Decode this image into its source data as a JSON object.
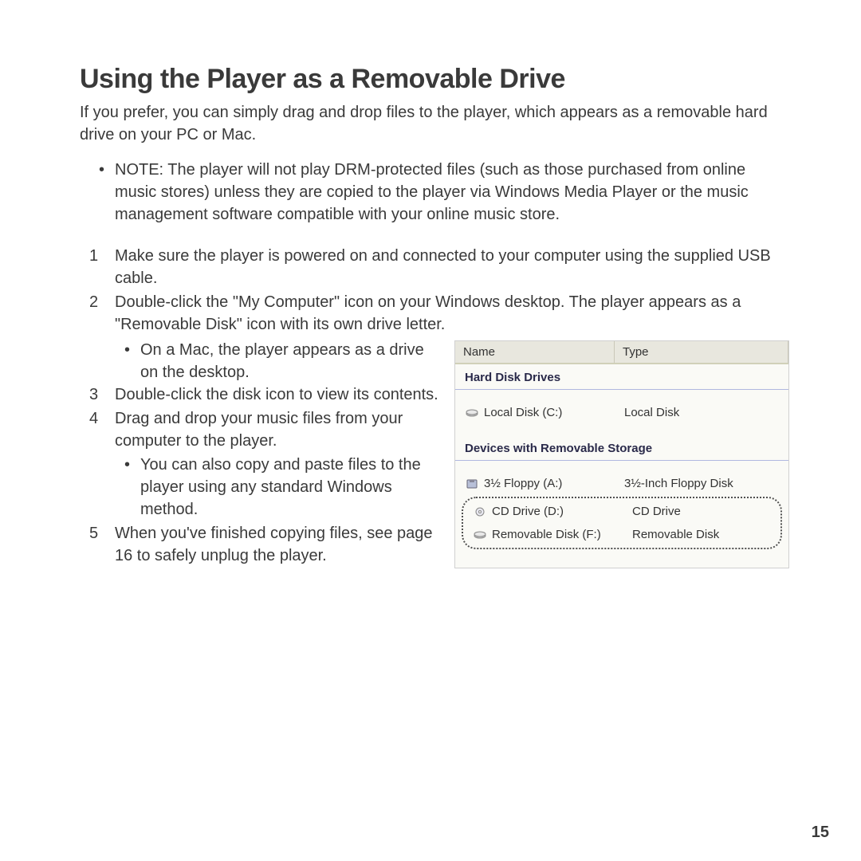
{
  "title": "Using the Player as a Removable Drive",
  "intro": "If you prefer, you can simply drag and drop files to the player, which appears as a removable hard drive on your PC or Mac.",
  "note": "NOTE: The player will not play DRM-protected files (such as those purchased from online music stores) unless they are copied to the player via Windows Media Player or the music management software compatible with your online music store.",
  "steps": {
    "s1": "Make sure the player is powered on and connected to your computer using the supplied USB cable.",
    "s2": "Double-click the \"My Computer\" icon on your Windows desktop. The player appears as a \"Removable Disk\" icon with its own drive letter.",
    "s2_sub": "On a Mac, the player appears as a drive on the desktop.",
    "s3": "Double-click the disk icon to view its contents.",
    "s4": "Drag and drop your music files from your computer to the player.",
    "s4_sub": "You can also copy and paste files to the player using any standard Windows method.",
    "s5": "When you've finished copying files, see page 16 to safely unplug the player."
  },
  "explorer": {
    "columns": {
      "name": "Name",
      "type": "Type"
    },
    "section1": "Hard Disk Drives",
    "drives1": [
      {
        "name": "Local Disk (C:)",
        "type": "Local Disk"
      }
    ],
    "section2": "Devices with Removable Storage",
    "drives2": [
      {
        "name": "3½ Floppy (A:)",
        "type": "3½-Inch Floppy Disk"
      },
      {
        "name": "CD Drive (D:)",
        "type": "CD Drive"
      },
      {
        "name": "Removable Disk (F:)",
        "type": "Removable Disk"
      }
    ]
  },
  "page_number": "15"
}
